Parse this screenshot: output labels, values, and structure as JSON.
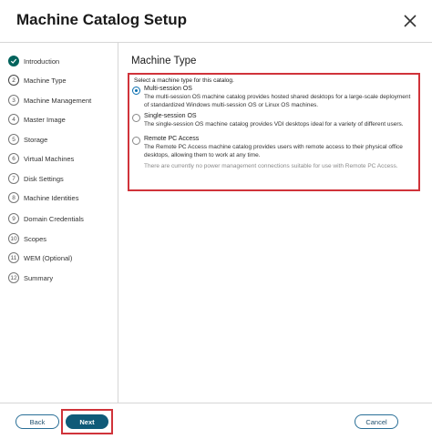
{
  "dialog": {
    "title": "Machine Catalog Setup",
    "close_icon": "close-icon"
  },
  "sidebar": {
    "steps": [
      {
        "num": "",
        "label": "Introduction",
        "state": "done"
      },
      {
        "num": "2",
        "label": "Machine Type",
        "state": "current"
      },
      {
        "num": "3",
        "label": "Machine Management",
        "state": "pending"
      },
      {
        "num": "4",
        "label": "Master Image",
        "state": "pending"
      },
      {
        "num": "5",
        "label": "Storage",
        "state": "pending"
      },
      {
        "num": "6",
        "label": "Virtual Machines",
        "state": "pending"
      },
      {
        "num": "7",
        "label": "Disk Settings",
        "state": "pending"
      },
      {
        "num": "8",
        "label": "Machine Identities",
        "state": "pending"
      },
      {
        "num": "9",
        "label": "Domain Credentials",
        "state": "pending"
      },
      {
        "num": "10",
        "label": "Scopes",
        "state": "pending"
      },
      {
        "num": "11",
        "label": "WEM (Optional)",
        "state": "pending"
      },
      {
        "num": "12",
        "label": "Summary",
        "state": "pending"
      }
    ]
  },
  "main": {
    "section_title": "Machine Type",
    "intro": "Select a machine type for this catalog.",
    "options": [
      {
        "label": "Multi-session OS",
        "description": "The multi-session OS machine catalog provides hosted shared desktops for a large-scale deployment of standardized Windows multi-session OS or Linux OS machines.",
        "checked": true
      },
      {
        "label": "Single-session OS",
        "description": "The single-session OS machine catalog provides VDI desktops ideal for a variety of different users.",
        "checked": false
      },
      {
        "label": "Remote PC Access",
        "description": "The Remote PC Access machine catalog provides users with remote access to their physical office desktops, allowing them to work at any time.",
        "checked": false
      }
    ],
    "note": "There are currently no power management connections suitable for use with Remote PC Access."
  },
  "footer": {
    "back_label": "Back",
    "next_label": "Next",
    "cancel_label": "Cancel"
  },
  "colors": {
    "accent": "#0f5a78",
    "done_step": "#02635c",
    "highlight": "#d0333a"
  }
}
